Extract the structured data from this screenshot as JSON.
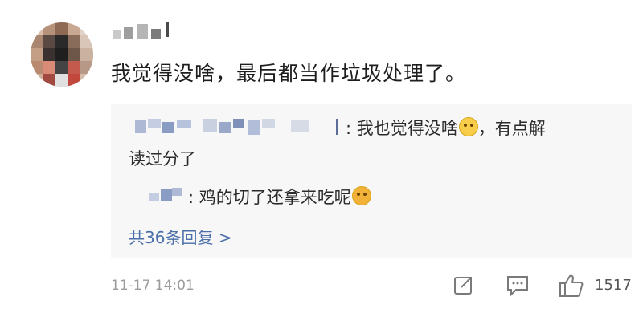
{
  "comment": {
    "text": "我觉得没啥，最后都当作垃圾处理了。",
    "timestamp": "11-17 14:01",
    "like_count": "1517"
  },
  "replies": [
    {
      "text_line1": ": 我也觉得没啥",
      "text_line1_tail": "，有点解",
      "text_line2": "读过分了",
      "emoji": "laughing-tears-emoji"
    },
    {
      "text": ": 鸡的切了还拿来吃呢",
      "emoji": "shocked-emoji"
    }
  ],
  "more_replies_label": "共36条回复 >",
  "icons": [
    "share-icon",
    "comment-icon",
    "like-icon"
  ],
  "colors": {
    "link": "#4b6fa8",
    "reply_bg": "#f7f7f7",
    "meta": "#9b9b9b"
  }
}
